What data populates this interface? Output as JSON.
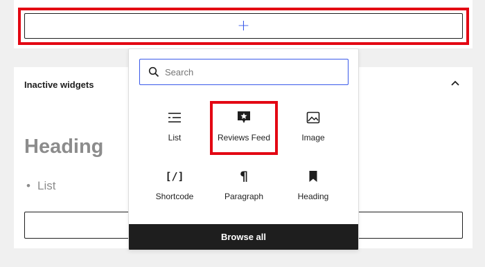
{
  "top": {
    "appender_icon": "plus-icon",
    "appender_symbol": "+"
  },
  "inactive_widgets": {
    "title": "Inactive widgets",
    "toggle_icon": "chevron-up-icon",
    "heading": "Heading",
    "list_item": "List"
  },
  "inserter": {
    "search": {
      "placeholder": "Search",
      "icon": "search-icon"
    },
    "blocks": [
      {
        "label": "List",
        "icon": "list-icon"
      },
      {
        "label": "Reviews Feed",
        "icon": "reviews-feed-icon"
      },
      {
        "label": "Image",
        "icon": "image-icon"
      },
      {
        "label": "Shortcode",
        "icon": "shortcode-icon",
        "symbol": "[/]"
      },
      {
        "label": "Paragraph",
        "icon": "paragraph-icon",
        "symbol": "¶"
      },
      {
        "label": "Heading",
        "icon": "bookmark-icon"
      }
    ],
    "browse_all": "Browse all"
  },
  "colors": {
    "highlight": "#e30613",
    "accent": "#3858e9",
    "dark": "#1e1e1e",
    "muted_text": "#8c8c8c",
    "background": "#f0f0f0"
  }
}
